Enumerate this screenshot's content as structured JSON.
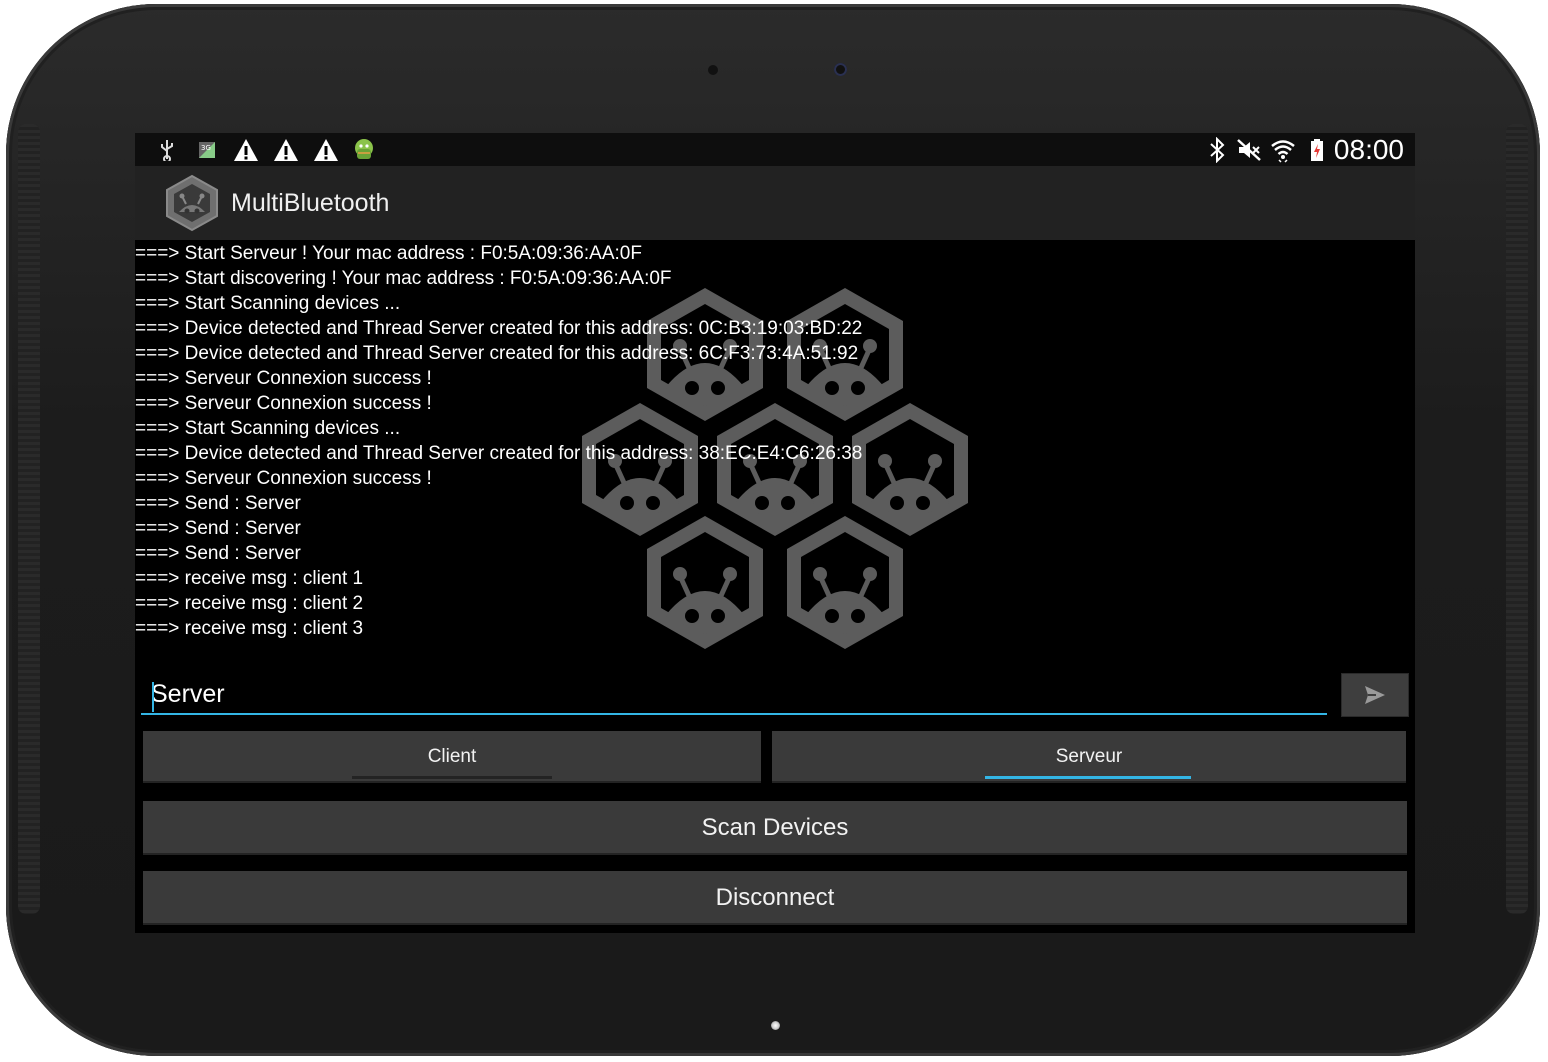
{
  "status_bar": {
    "time": "08:00",
    "left_icons": [
      "usb-icon",
      "3g-data-icon",
      "warning-icon",
      "warning-icon",
      "warning-icon",
      "android-debug-icon"
    ],
    "right_icons": [
      "bluetooth-icon",
      "mute-icon",
      "wifi-icon",
      "battery-charging-icon"
    ]
  },
  "action_bar": {
    "title": "MultiBluetooth",
    "logo_icon": "hex-robot-logo-icon"
  },
  "log": {
    "lines": [
      "===> Start Serveur ! Your mac address : F0:5A:09:36:AA:0F",
      "===> Start discovering ! Your mac address : F0:5A:09:36:AA:0F",
      "===> Start Scanning devices ...",
      "===> Device detected and Thread Server created for this address: 0C:B3:19:03:BD:22",
      "===> Device detected and Thread Server created for this address: 6C:F3:73:4A:51:92",
      "===> Serveur Connexion success !",
      "===> Serveur Connexion success !",
      "===> Start Scanning devices ...",
      "===> Device detected and Thread Server created for this address: 38:EC:E4:C6:26:38",
      "===> Serveur Connexion success !",
      "===> Send : Server",
      "===> Send : Server",
      "===> Send : Server",
      "===> receive msg : client 1",
      "===> receive msg : client 2",
      "===> receive msg : client 3"
    ]
  },
  "message_input": {
    "value": "Server"
  },
  "send_button": {
    "icon": "send-icon"
  },
  "mode_tabs": {
    "client_label": "Client",
    "server_label": "Serveur",
    "selected": "Serveur",
    "accent_color": "#33b5e5"
  },
  "actions": {
    "scan_label": "Scan Devices",
    "disconnect_label": "Disconnect"
  }
}
